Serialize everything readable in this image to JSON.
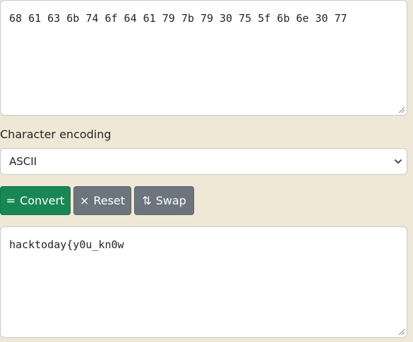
{
  "input": {
    "value": "68 61 63 6b 74 6f 64 61 79 7b 79 30 75 5f 6b 6e 30 77"
  },
  "encoding": {
    "label": "Character encoding",
    "selected": "ASCII"
  },
  "buttons": {
    "convert_glyph": "=",
    "convert_label": "Convert",
    "reset_glyph": "×",
    "reset_label": "Reset",
    "swap_glyph": "⇅",
    "swap_label": "Swap"
  },
  "output": {
    "value": "hacktoday{y0u_kn0w"
  }
}
